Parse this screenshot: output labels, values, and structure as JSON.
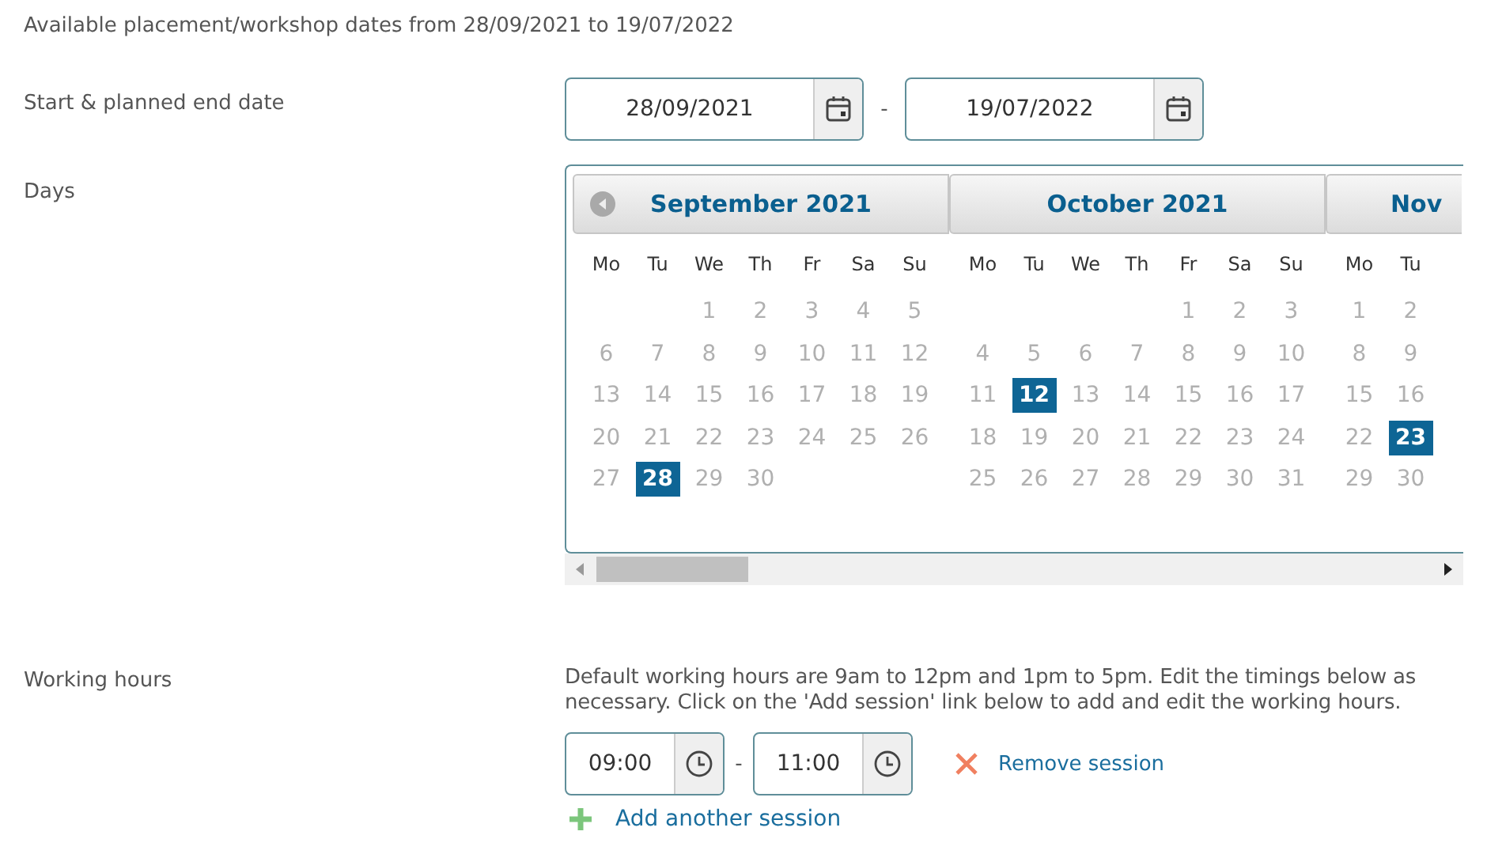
{
  "intro": "Available placement/workshop dates from 28/09/2021 to 19/07/2022",
  "dates": {
    "label": "Start & planned end date",
    "start": "28/09/2021",
    "separator": "-",
    "end": "19/07/2022"
  },
  "days": {
    "label": "Days",
    "months": [
      {
        "title": "September 2021",
        "weekdays": [
          "Mo",
          "Tu",
          "We",
          "Th",
          "Fr",
          "Sa",
          "Su"
        ],
        "weeks": [
          [
            {
              "d": "1",
              "selected": false
            },
            {
              "d": "2",
              "selected": false
            },
            {
              "d": "3",
              "selected": false
            },
            {
              "d": "4",
              "selected": false
            },
            {
              "d": "5",
              "selected": false
            }
          ],
          [
            {
              "d": "6",
              "selected": false
            },
            {
              "d": "7",
              "selected": false
            },
            {
              "d": "8",
              "selected": false
            },
            {
              "d": "9",
              "selected": false
            },
            {
              "d": "10",
              "selected": false
            },
            {
              "d": "11",
              "selected": false
            },
            {
              "d": "12",
              "selected": false
            }
          ],
          [
            {
              "d": "13",
              "selected": false
            },
            {
              "d": "14",
              "selected": false
            },
            {
              "d": "15",
              "selected": false
            },
            {
              "d": "16",
              "selected": false
            },
            {
              "d": "17",
              "selected": false
            },
            {
              "d": "18",
              "selected": false
            },
            {
              "d": "19",
              "selected": false
            }
          ],
          [
            {
              "d": "20",
              "selected": false
            },
            {
              "d": "21",
              "selected": false
            },
            {
              "d": "22",
              "selected": false
            },
            {
              "d": "23",
              "selected": false
            },
            {
              "d": "24",
              "selected": false
            },
            {
              "d": "25",
              "selected": false
            },
            {
              "d": "26",
              "selected": false
            }
          ],
          [
            {
              "d": "27",
              "selected": false
            },
            {
              "d": "28",
              "selected": true
            },
            {
              "d": "29",
              "selected": false
            },
            {
              "d": "30",
              "selected": false
            }
          ]
        ]
      },
      {
        "title": "October 2021",
        "weekdays": [
          "Mo",
          "Tu",
          "We",
          "Th",
          "Fr",
          "Sa",
          "Su"
        ],
        "weeks": [
          [
            {
              "d": "1",
              "selected": false
            },
            {
              "d": "2",
              "selected": false
            },
            {
              "d": "3",
              "selected": false
            }
          ],
          [
            {
              "d": "4",
              "selected": false
            },
            {
              "d": "5",
              "selected": false
            },
            {
              "d": "6",
              "selected": false
            },
            {
              "d": "7",
              "selected": false
            },
            {
              "d": "8",
              "selected": false
            },
            {
              "d": "9",
              "selected": false
            },
            {
              "d": "10",
              "selected": false
            }
          ],
          [
            {
              "d": "11",
              "selected": false
            },
            {
              "d": "12",
              "selected": true
            },
            {
              "d": "13",
              "selected": false
            },
            {
              "d": "14",
              "selected": false
            },
            {
              "d": "15",
              "selected": false
            },
            {
              "d": "16",
              "selected": false
            },
            {
              "d": "17",
              "selected": false
            }
          ],
          [
            {
              "d": "18",
              "selected": false
            },
            {
              "d": "19",
              "selected": false
            },
            {
              "d": "20",
              "selected": false
            },
            {
              "d": "21",
              "selected": false
            },
            {
              "d": "22",
              "selected": false
            },
            {
              "d": "23",
              "selected": false
            },
            {
              "d": "24",
              "selected": false
            }
          ],
          [
            {
              "d": "25",
              "selected": false
            },
            {
              "d": "26",
              "selected": false
            },
            {
              "d": "27",
              "selected": false
            },
            {
              "d": "28",
              "selected": false
            },
            {
              "d": "29",
              "selected": false
            },
            {
              "d": "30",
              "selected": false
            },
            {
              "d": "31",
              "selected": false
            }
          ]
        ]
      },
      {
        "title": "Nov",
        "weekdays": [
          "Mo",
          "Tu"
        ],
        "weeks": [
          [
            {
              "d": "1",
              "selected": false
            },
            {
              "d": "2",
              "selected": false
            }
          ],
          [
            {
              "d": "8",
              "selected": false
            },
            {
              "d": "9",
              "selected": false
            }
          ],
          [
            {
              "d": "15",
              "selected": false
            },
            {
              "d": "16",
              "selected": false
            }
          ],
          [
            {
              "d": "22",
              "selected": false
            },
            {
              "d": "23",
              "selected": true
            }
          ],
          [
            {
              "d": "29",
              "selected": false
            },
            {
              "d": "30",
              "selected": false
            }
          ]
        ]
      }
    ]
  },
  "working_hours": {
    "label": "Working hours",
    "description": "Default working hours are 9am to 12pm and 1pm to 5pm. Edit the timings below as necessary. Click on the 'Add session' link below to add and edit the working hours.",
    "sessions": [
      {
        "start": "09:00",
        "separator": "-",
        "end": "11:00",
        "remove": "Remove session"
      }
    ],
    "add": "Add another session"
  }
}
